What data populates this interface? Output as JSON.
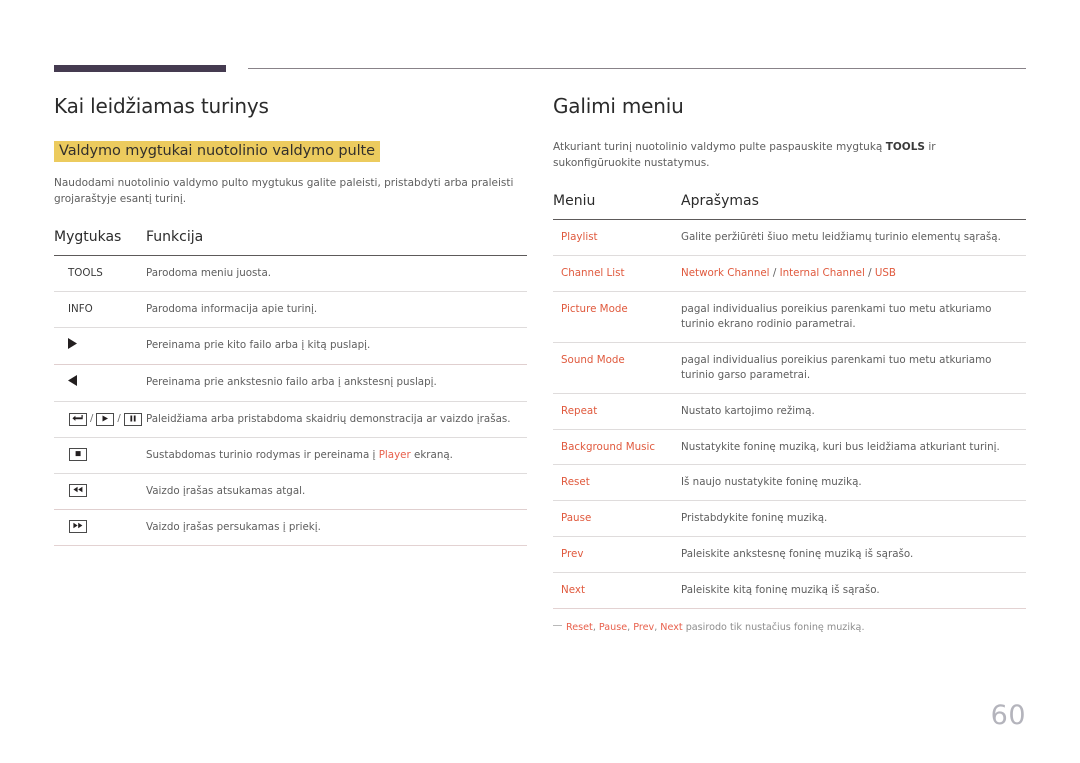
{
  "page": {
    "number": "60",
    "accent_purple": "#453b50",
    "accent_orange": "#e05a3e",
    "highlight_yellow": "#eccb5e"
  },
  "left": {
    "title": "Kai leidžiamas turinys",
    "subhead": "Valdymo mygtukai nuotolinio valdymo pulte",
    "intro": "Naudodami nuotolinio valdymo pulto mygtukus galite paleisti, pristabdyti arba praleisti grojaraštyje esantį turinį.",
    "table": {
      "headers": [
        "Mygtukas",
        "Funkcija"
      ],
      "rows": [
        {
          "key_text": "TOOLS",
          "key_icons": [],
          "desc_pre": "Parodoma meniu juosta.",
          "desc_link": "",
          "desc_post": ""
        },
        {
          "key_text": "INFO",
          "key_icons": [],
          "desc_pre": "Parodoma informacija apie turinį.",
          "desc_link": "",
          "desc_post": ""
        },
        {
          "key_text": "",
          "key_icons": [
            "play-triangle-right-icon"
          ],
          "desc_pre": "Pereinama prie kito failo arba į kitą puslapį.",
          "desc_link": "",
          "desc_post": ""
        },
        {
          "key_text": "",
          "key_icons": [
            "play-triangle-left-icon"
          ],
          "desc_pre": "Pereinama prie ankstesnio failo arba į ankstesnį puslapį.",
          "desc_link": "",
          "desc_post": ""
        },
        {
          "key_text": "",
          "key_icons": [
            "enter-key-icon",
            "play-key-icon",
            "pause-key-icon"
          ],
          "desc_pre": "Paleidžiama arba pristabdoma skaidrių demonstracija ar vaizdo įrašas.",
          "desc_link": "",
          "desc_post": ""
        },
        {
          "key_text": "",
          "key_icons": [
            "stop-key-icon"
          ],
          "desc_pre": "Sustabdomas turinio rodymas ir pereinama į ",
          "desc_link": "Player",
          "desc_post": " ekraną."
        },
        {
          "key_text": "",
          "key_icons": [
            "rewind-key-icon"
          ],
          "desc_pre": "Vaizdo įrašas atsukamas atgal.",
          "desc_link": "",
          "desc_post": ""
        },
        {
          "key_text": "",
          "key_icons": [
            "fast-forward-key-icon"
          ],
          "desc_pre": "Vaizdo įrašas persukamas į priekį.",
          "desc_link": "",
          "desc_post": ""
        }
      ]
    }
  },
  "right": {
    "title": "Galimi meniu",
    "intro_pre": "Atkuriant turinį nuotolinio valdymo pulte paspauskite mygtuką ",
    "intro_bold": "TOOLS",
    "intro_post": " ir sukonfigūruokite nustatymus.",
    "table": {
      "headers": [
        "Meniu",
        "Aprašymas"
      ],
      "rows": [
        {
          "menu": "Playlist",
          "desc": "Galite peržiūrėti šiuo metu leidžiamų turinio elementų sąrašą.",
          "desc_highlight": false
        },
        {
          "menu": "Channel List",
          "desc": "Network Channel / Internal Channel / USB",
          "desc_highlight": true
        },
        {
          "menu": "Picture Mode",
          "desc": "pagal individualius poreikius parenkami tuo metu atkuriamo turinio ekrano rodinio parametrai.",
          "desc_highlight": false
        },
        {
          "menu": "Sound Mode",
          "desc": "pagal individualius poreikius parenkami tuo metu atkuriamo turinio garso parametrai.",
          "desc_highlight": false
        },
        {
          "menu": "Repeat",
          "desc": "Nustato kartojimo režimą.",
          "desc_highlight": false
        },
        {
          "menu": "Background Music",
          "desc": "Nustatykite foninę muziką, kuri bus leidžiama atkuriant turinį.",
          "desc_highlight": false
        },
        {
          "menu": "Reset",
          "desc": "Iš naujo nustatykite foninę muziką.",
          "desc_highlight": false
        },
        {
          "menu": "Pause",
          "desc": "Pristabdykite foninę muziką.",
          "desc_highlight": false
        },
        {
          "menu": "Prev",
          "desc": "Paleiskite ankstesnę foninę muziką iš sąrašo.",
          "desc_highlight": false
        },
        {
          "menu": "Next",
          "desc": "Paleiskite kitą foninę muziką iš sąrašo.",
          "desc_highlight": false
        }
      ]
    },
    "footnote": {
      "items": [
        "Reset",
        "Pause",
        "Prev",
        "Next"
      ],
      "tail": " pasirodo tik nustačius foninę muziką."
    }
  }
}
